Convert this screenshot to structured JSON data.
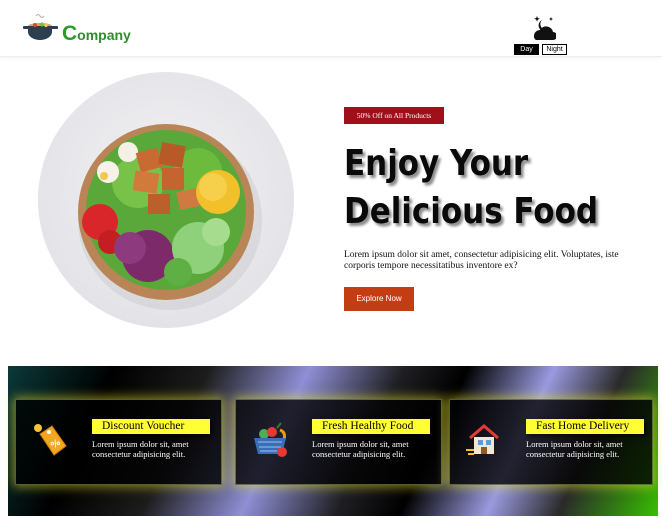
{
  "header": {
    "logo_letter": "C",
    "logo_rest": "ompany",
    "logo_icon": "cooking-pot-icon",
    "theme_icon": "moon-stars-icon",
    "day_label": "Day",
    "night_label": "Night"
  },
  "hero": {
    "image_icon": "salad-bowl-image",
    "badge": "50% Off on All Products",
    "title_line1": "Enjoy Your",
    "title_line2": "Delicious Food",
    "description": "Lorem ipsum dolor sit amet, consectetur adipisicing elit. Voluptates, iste corporis tempore necessitatibus inventore ex?",
    "cta_label": "Explore Now",
    "badge_color": "#a0101a",
    "cta_color": "#c43d12"
  },
  "features": [
    {
      "icon": "discount-tag-icon",
      "title": "Discount Voucher",
      "text": "Lorem ipsum dolor sit, amet consectetur adipisicing elit."
    },
    {
      "icon": "grocery-basket-icon",
      "title": "Fresh Healthy Food",
      "text": "Lorem ipsum dolor sit, amet consectetur adipisicing elit."
    },
    {
      "icon": "home-delivery-icon",
      "title": "Fast Home Delivery",
      "text": "Lorem ipsum dolor sit, amet consectetur adipisicing elit."
    }
  ],
  "colors": {
    "brand_green": "#2f8d2f",
    "feature_title_bg": "#ffff33"
  }
}
